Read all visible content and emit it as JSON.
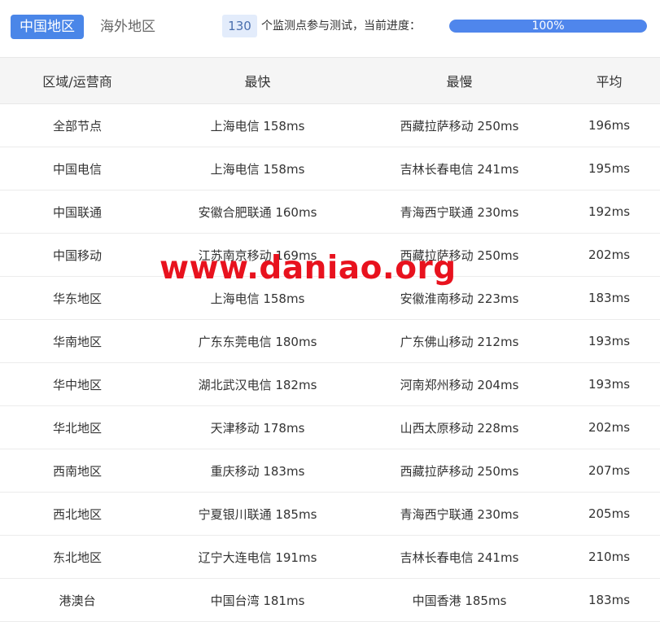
{
  "tabs": {
    "active": "中国地区",
    "inactive": "海外地区"
  },
  "progress": {
    "monitor_count": "130",
    "text": "个监测点参与测试，当前进度：",
    "percent_label": "100%",
    "fraction": 1.0,
    "color": "#4f86ec"
  },
  "table": {
    "headers": [
      "区域/运营商",
      "最快",
      "最慢",
      "平均"
    ],
    "rows": [
      [
        "全部节点",
        "上海电信 158ms",
        "西藏拉萨移动 250ms",
        "196ms"
      ],
      [
        "中国电信",
        "上海电信 158ms",
        "吉林长春电信 241ms",
        "195ms"
      ],
      [
        "中国联通",
        "安徽合肥联通 160ms",
        "青海西宁联通 230ms",
        "192ms"
      ],
      [
        "中国移动",
        "江苏南京移动 169ms",
        "西藏拉萨移动 250ms",
        "202ms"
      ],
      [
        "华东地区",
        "上海电信 158ms",
        "安徽淮南移动 223ms",
        "183ms"
      ],
      [
        "华南地区",
        "广东东莞电信 180ms",
        "广东佛山移动 212ms",
        "193ms"
      ],
      [
        "华中地区",
        "湖北武汉电信 182ms",
        "河南郑州移动 204ms",
        "193ms"
      ],
      [
        "华北地区",
        "天津移动 178ms",
        "山西太原移动 228ms",
        "202ms"
      ],
      [
        "西南地区",
        "重庆移动 183ms",
        "西藏拉萨移动 250ms",
        "207ms"
      ],
      [
        "西北地区",
        "宁夏银川联通 185ms",
        "青海西宁联通 230ms",
        "205ms"
      ],
      [
        "东北地区",
        "辽宁大连电信 191ms",
        "吉林长春电信 241ms",
        "210ms"
      ],
      [
        "港澳台",
        "中国台湾 181ms",
        "中国香港 185ms",
        "183ms"
      ]
    ]
  },
  "watermark": {
    "text": "www.daniao.org",
    "color": "#e8121e"
  },
  "colors": {
    "accent": "#4a86e8",
    "header_bg": "#f5f5f5"
  }
}
